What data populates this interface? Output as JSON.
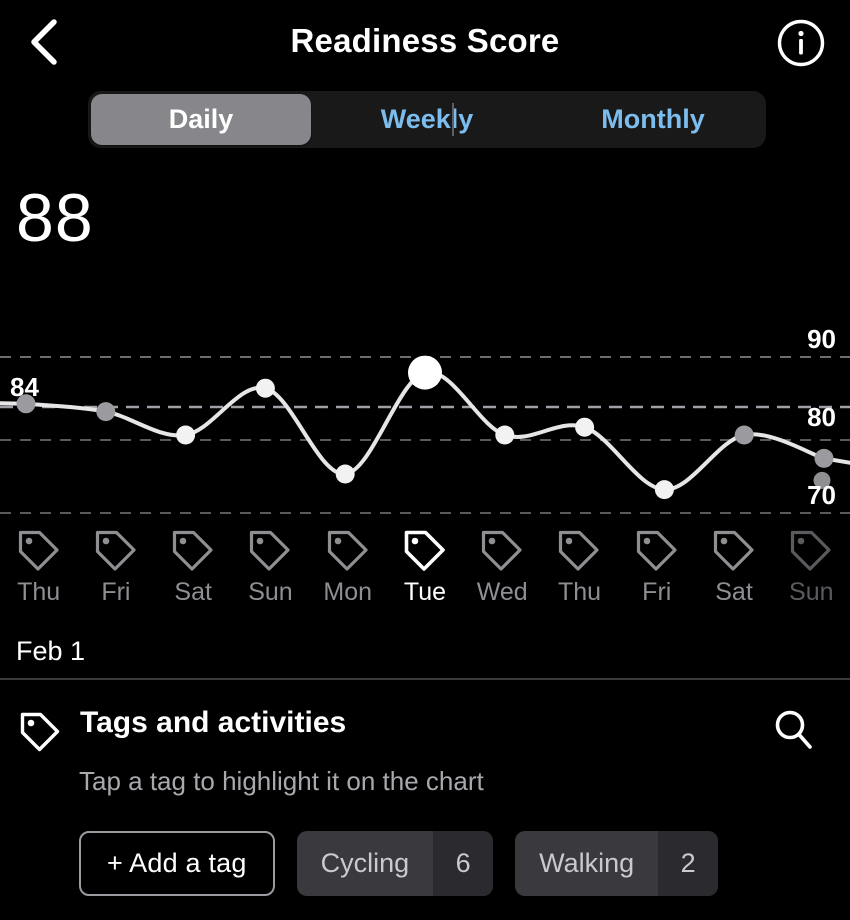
{
  "header": {
    "title": "Readiness Score",
    "back_icon": "chevron-left-icon",
    "info_icon": "info-circle-icon"
  },
  "segmented": {
    "options": [
      {
        "label": "Daily",
        "active": true
      },
      {
        "label": "Weekly",
        "active": false
      },
      {
        "label": "Monthly",
        "active": false
      }
    ],
    "active_bg": "#86868b",
    "inactive_color": "#7cbdee",
    "track_bg": "#191919"
  },
  "score": {
    "value": "88"
  },
  "chart_data": {
    "type": "line",
    "title": "Readiness Score",
    "xlabel": "",
    "ylabel": "",
    "ylim": [
      65,
      93
    ],
    "yticks": [
      90,
      80,
      70
    ],
    "ytick_labels": [
      "90",
      "80",
      "70"
    ],
    "grid": true,
    "grid_style": "dashed",
    "point_value_label": "84",
    "selected_index": 5,
    "categories": [
      "Thu",
      "Fri",
      "Sat",
      "Sun",
      "Mon",
      "Tue",
      "Wed",
      "Thu",
      "Fri",
      "Sat",
      "Sun"
    ],
    "values": [
      84,
      83,
      80,
      86,
      75,
      88,
      80,
      81,
      73,
      80,
      77
    ],
    "series": [
      {
        "name": "Readiness Score",
        "values": [
          84,
          83,
          80,
          86,
          75,
          88,
          80,
          81,
          73,
          80,
          77
        ]
      }
    ],
    "line_color": "#e6e6e6",
    "point_color": "#ffffff"
  },
  "days": [
    {
      "label": "Thu",
      "icon": "tag-icon",
      "state": "normal"
    },
    {
      "label": "Fri",
      "icon": "tag-icon",
      "state": "normal"
    },
    {
      "label": "Sat",
      "icon": "tag-icon",
      "state": "normal"
    },
    {
      "label": "Sun",
      "icon": "tag-icon",
      "state": "normal"
    },
    {
      "label": "Mon",
      "icon": "tag-icon",
      "state": "normal"
    },
    {
      "label": "Tue",
      "icon": "tag-icon",
      "state": "selected"
    },
    {
      "label": "Wed",
      "icon": "tag-icon",
      "state": "normal"
    },
    {
      "label": "Thu",
      "icon": "tag-icon",
      "state": "normal"
    },
    {
      "label": "Fri",
      "icon": "tag-icon",
      "state": "normal"
    },
    {
      "label": "Sat",
      "icon": "tag-icon",
      "state": "normal"
    },
    {
      "label": "Sun",
      "icon": "tag-icon",
      "state": "faded"
    }
  ],
  "date_label": "Feb 1",
  "tags_section": {
    "icon": "tag-icon",
    "title": "Tags and activities",
    "subtitle": "Tap a tag to highlight it on the chart",
    "search_icon": "search-icon",
    "add_tag_label": "+ Add a tag",
    "chips": [
      {
        "name": "Cycling",
        "count": "6"
      },
      {
        "name": "Walking",
        "count": "2"
      }
    ]
  }
}
